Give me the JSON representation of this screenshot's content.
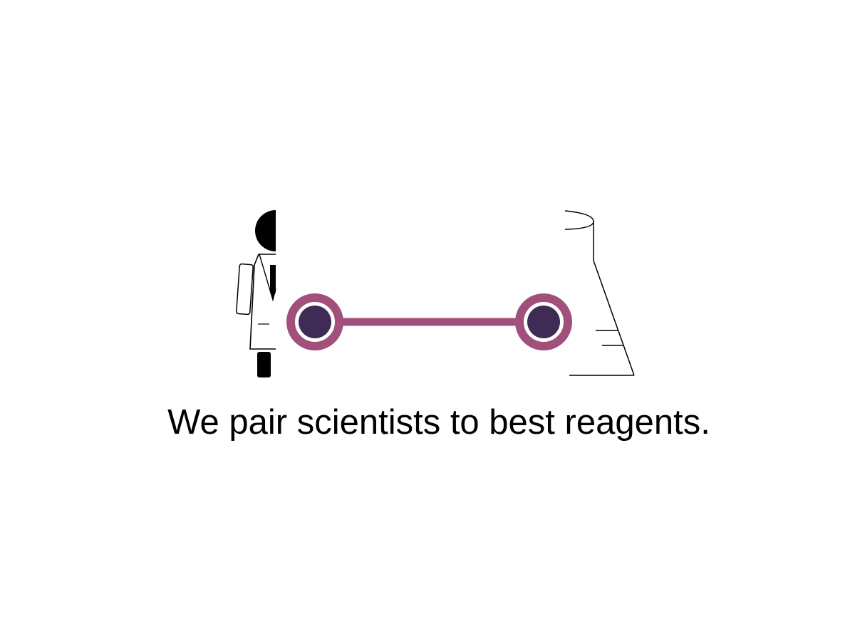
{
  "slide": {
    "tagline": "We pair scientists to best reagents."
  },
  "graphic": {
    "left_icon": "scientist-icon",
    "right_icon": "flask-icon",
    "connector_icon": "pairing-link-icon",
    "colors": {
      "link": "#a0507a",
      "node_fill": "#402a56",
      "outline": "#000000",
      "background": "#ffffff"
    }
  }
}
